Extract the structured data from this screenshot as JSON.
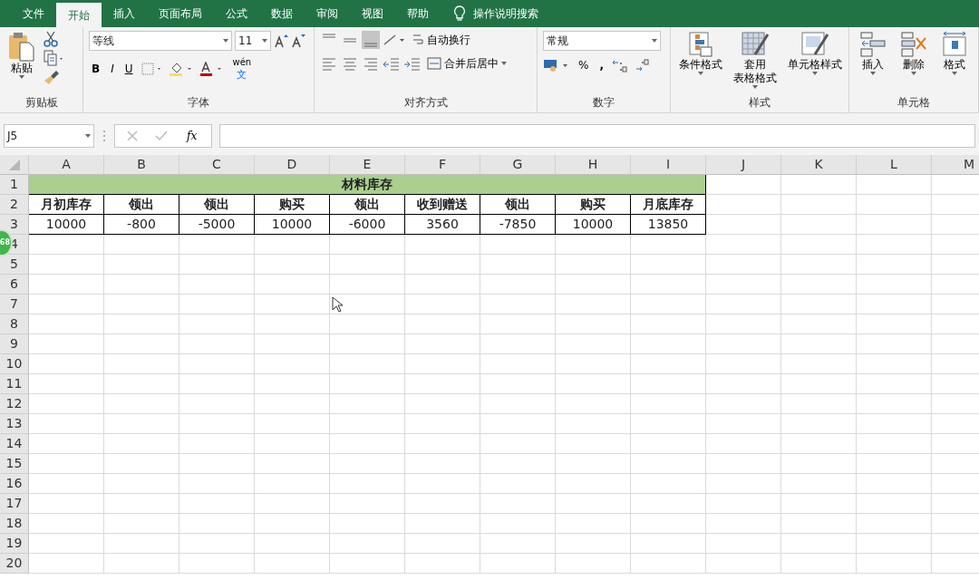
{
  "menu_tabs": [
    {
      "label": "文件",
      "selected": false
    },
    {
      "label": "开始",
      "selected": true
    },
    {
      "label": "插入",
      "selected": false
    },
    {
      "label": "页面布局",
      "selected": false
    },
    {
      "label": "公式",
      "selected": false
    },
    {
      "label": "数据",
      "selected": false
    },
    {
      "label": "审阅",
      "selected": false
    },
    {
      "label": "视图",
      "selected": false
    },
    {
      "label": "帮助",
      "selected": false
    }
  ],
  "tell_me": {
    "label": "操作说明搜索"
  },
  "ribbon": {
    "clipboard": {
      "paste": "粘贴",
      "label": "剪贴板"
    },
    "font": {
      "font_name": "等线",
      "font_size": "11",
      "bold": "B",
      "italic": "I",
      "underline": "U",
      "phonetic": [
        "wén",
        "文"
      ],
      "label": "字体"
    },
    "alignment": {
      "vertical": [
        {
          "selected": false
        },
        {
          "selected": false
        },
        {
          "selected": true
        }
      ],
      "wrap_text": "自动换行",
      "merge_center": "合并后居中",
      "label": "对齐方式"
    },
    "number": {
      "format": "常规",
      "percent": "%",
      "comma": ",",
      "label": "数字"
    },
    "styles": {
      "buttons": [
        [
          "条件格式"
        ],
        [
          "套用",
          "表格格式"
        ],
        [
          "单元格样式"
        ]
      ],
      "label": "样式"
    },
    "cells": {
      "buttons": [
        "插入",
        "删除",
        "格式"
      ],
      "label": "单元格"
    }
  },
  "name_box": "J5",
  "formula_bar": {
    "fx": "fx"
  },
  "columns": [
    "A",
    "B",
    "C",
    "D",
    "E",
    "F",
    "G",
    "H",
    "I",
    "J",
    "K",
    "L",
    "M"
  ],
  "rows": [
    {
      "header": "1",
      "title": "材料库存"
    },
    {
      "header": "2",
      "cells": [
        "月初库存",
        "领出",
        "领出",
        "购买",
        "领出",
        "收到赠送",
        "领出",
        "购买",
        "月底库存"
      ]
    },
    {
      "header": "3",
      "cells": [
        "10000",
        "-800",
        "-5000",
        "10000",
        "-6000",
        "3560",
        "-7850",
        "10000",
        "13850"
      ]
    },
    {
      "header": "4"
    },
    {
      "header": "5"
    },
    {
      "header": "6"
    },
    {
      "header": "7"
    },
    {
      "header": "8"
    },
    {
      "header": "9"
    },
    {
      "header": "10"
    },
    {
      "header": "11"
    },
    {
      "header": "12"
    },
    {
      "header": "13"
    },
    {
      "header": "14"
    },
    {
      "header": "15"
    },
    {
      "header": "16"
    },
    {
      "header": "17"
    },
    {
      "header": "18"
    },
    {
      "header": "19"
    },
    {
      "header": "20"
    }
  ],
  "overlay_badge": "68"
}
